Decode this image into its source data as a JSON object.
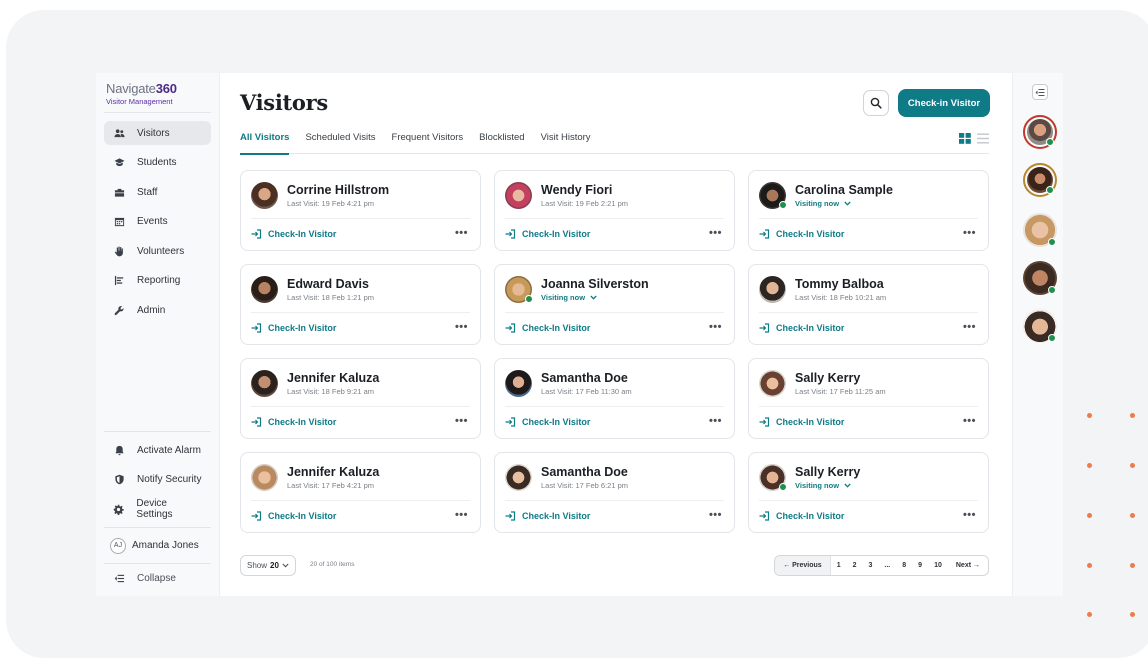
{
  "brand": {
    "name_light": "Navigate",
    "name_bold": "360",
    "subtitle": "Visitor Management"
  },
  "sidebar": {
    "items": [
      {
        "label": "Visitors",
        "icon": "users-icon",
        "active": true
      },
      {
        "label": "Students",
        "icon": "graduation-cap-icon"
      },
      {
        "label": "Staff",
        "icon": "briefcase-icon"
      },
      {
        "label": "Events",
        "icon": "calendar-icon"
      },
      {
        "label": "Volunteers",
        "icon": "hand-icon"
      },
      {
        "label": "Reporting",
        "icon": "report-icon"
      },
      {
        "label": "Admin",
        "icon": "wrench-icon"
      }
    ],
    "bottom": [
      {
        "label": "Activate Alarm",
        "icon": "bell-icon"
      },
      {
        "label": "Notify Security",
        "icon": "shield-icon"
      },
      {
        "label": "Device Settings",
        "icon": "gear-icon"
      }
    ],
    "user": {
      "initials": "AJ",
      "name": "Amanda Jones"
    },
    "collapse_label": "Collapse"
  },
  "header": {
    "title": "Visitors",
    "checkin_label": "Check-in Visitor"
  },
  "tabs": [
    {
      "label": "All Visitors",
      "active": true
    },
    {
      "label": "Scheduled Visits"
    },
    {
      "label": "Frequent Visitors"
    },
    {
      "label": "Blocklisted"
    },
    {
      "label": "Visit History"
    }
  ],
  "cards": [
    {
      "name": "Corrine Hillstrom",
      "status": "Last Visit: 19 Feb 4:21 pm",
      "visiting": false
    },
    {
      "name": "Wendy Fiori",
      "status": "Last Visit: 19 Feb 2:21 pm",
      "visiting": false
    },
    {
      "name": "Carolina Sample",
      "status": "Visiting now",
      "visiting": true
    },
    {
      "name": "Edward Davis",
      "status": "Last Visit: 18 Feb 1:21 pm",
      "visiting": false
    },
    {
      "name": "Joanna Silverston",
      "status": "Visiting now",
      "visiting": true
    },
    {
      "name": "Tommy Balboa",
      "status": "Last Visit: 18 Feb 10:21 am",
      "visiting": false
    },
    {
      "name": "Jennifer Kaluza",
      "status": "Last Visit: 18 Feb 9:21 am",
      "visiting": false
    },
    {
      "name": "Samantha Doe",
      "status": "Last Visit: 17 Feb 11:30 am",
      "visiting": false
    },
    {
      "name": "Sally Kerry",
      "status": "Last Visit: 17 Feb 11:25 am",
      "visiting": false
    },
    {
      "name": "Jennifer Kaluza",
      "status": "Last Visit: 17 Feb 4:21 pm",
      "visiting": false
    },
    {
      "name": "Samantha Doe",
      "status": "Last Visit: 17 Feb 6:21 pm",
      "visiting": false
    },
    {
      "name": "Sally Kerry",
      "status": "Visiting now",
      "visiting": true
    }
  ],
  "card_action_label": "Check-In Visitor",
  "footer": {
    "show_label": "Show",
    "show_value": "20",
    "count_text": "20 of 100 items",
    "prev_label": "← Previous",
    "next_label": "Next →",
    "pages": [
      "1",
      "2",
      "3",
      "...",
      "8",
      "9",
      "10"
    ]
  },
  "colors": {
    "accent": "#0f7b86",
    "brand": "#4b2a86",
    "online": "#1f8f4e",
    "decor": "#f07a4a"
  }
}
